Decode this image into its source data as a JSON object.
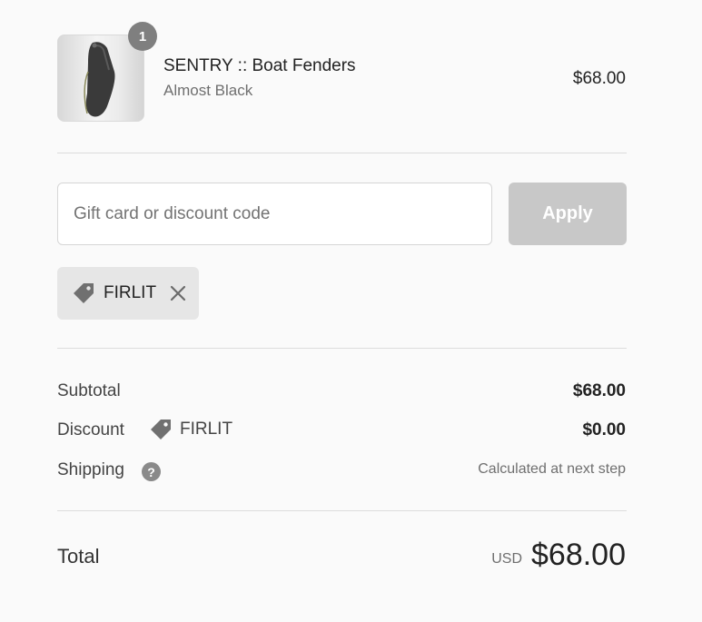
{
  "product": {
    "quantity": "1",
    "name": "SENTRY :: Boat Fenders",
    "variant": "Almost Black",
    "price": "$68.00"
  },
  "discount_form": {
    "placeholder": "Gift card or discount code",
    "apply_label": "Apply"
  },
  "applied_discount": {
    "code": "FIRLIT",
    "icon": "tag-icon",
    "remove_icon": "close-icon"
  },
  "summary": {
    "subtotal_label": "Subtotal",
    "subtotal_value": "$68.00",
    "discount_label": "Discount",
    "discount_code": "FIRLIT",
    "discount_value": "$0.00",
    "shipping_label": "Shipping",
    "shipping_help_icon": "question-icon",
    "shipping_value": "Calculated at next step",
    "total_label": "Total",
    "currency": "USD",
    "total_value": "$68.00"
  },
  "colors": {
    "apply_disabled": "#c8c8c8",
    "badge": "#7f7f7f",
    "chip_bg": "#e6e6e6"
  }
}
